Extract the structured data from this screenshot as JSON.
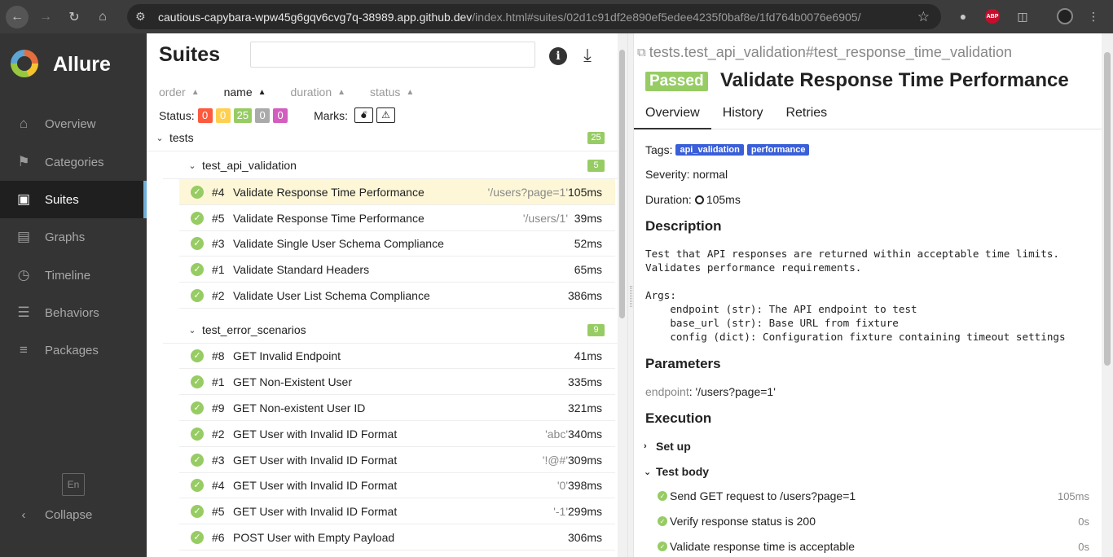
{
  "browser": {
    "url_host": "cautious-capybara-wpw45g6gqv6cvg7q-38989.app.github.dev",
    "url_path": "/index.html#suites/02d1c91df2e890ef5edee4235f0baf8e/1fd764b0076e6905/",
    "back_icon": "arrow-left",
    "forward_icon": "arrow-right",
    "reload_icon": "reload",
    "home_icon": "home",
    "abp_label": "ABP"
  },
  "sidebar": {
    "brand": "Allure",
    "items": [
      {
        "label": "Overview",
        "icon": "home"
      },
      {
        "label": "Categories",
        "icon": "flag"
      },
      {
        "label": "Suites",
        "icon": "briefcase"
      },
      {
        "label": "Graphs",
        "icon": "bar-chart"
      },
      {
        "label": "Timeline",
        "icon": "clock"
      },
      {
        "label": "Behaviors",
        "icon": "list"
      },
      {
        "label": "Packages",
        "icon": "align-left"
      }
    ],
    "active": "Suites",
    "lang": "En",
    "collapse": "Collapse"
  },
  "suites": {
    "title": "Suites",
    "search_placeholder": "",
    "sorters": [
      {
        "label": "order",
        "active": false
      },
      {
        "label": "name",
        "active": true
      },
      {
        "label": "duration",
        "active": false
      },
      {
        "label": "status",
        "active": false
      }
    ],
    "status_label": "Status:",
    "status_counts": [
      {
        "value": "0",
        "color": "#fd5a3e"
      },
      {
        "value": "0",
        "color": "#ffd050"
      },
      {
        "value": "25",
        "color": "#97cc64"
      },
      {
        "value": "0",
        "color": "#aaaaaa"
      },
      {
        "value": "0",
        "color": "#d35ebe"
      }
    ],
    "marks_label": "Marks:",
    "root": {
      "name": "tests",
      "count": "25"
    },
    "groups": [
      {
        "name": "test_api_validation",
        "count": "5",
        "rows": [
          {
            "num": "#4",
            "name": "Validate Response Time Performance",
            "param": "'/users?page=1'",
            "duration": "105ms",
            "selected": true
          },
          {
            "num": "#5",
            "name": "Validate Response Time Performance",
            "param": "'/users/1'",
            "duration": "39ms"
          },
          {
            "num": "#3",
            "name": "Validate Single User Schema Compliance",
            "param": "",
            "duration": "52ms"
          },
          {
            "num": "#1",
            "name": "Validate Standard Headers",
            "param": "",
            "duration": "65ms"
          },
          {
            "num": "#2",
            "name": "Validate User List Schema Compliance",
            "param": "",
            "duration": "386ms"
          }
        ]
      },
      {
        "name": "test_error_scenarios",
        "count": "9",
        "rows": [
          {
            "num": "#8",
            "name": "GET Invalid Endpoint",
            "param": "",
            "duration": "41ms"
          },
          {
            "num": "#1",
            "name": "GET Non-Existent User",
            "param": "",
            "duration": "335ms"
          },
          {
            "num": "#9",
            "name": "GET Non-existent User ID",
            "param": "",
            "duration": "321ms"
          },
          {
            "num": "#2",
            "name": "GET User with Invalid ID Format",
            "param": "'abc'",
            "duration": "340ms"
          },
          {
            "num": "#3",
            "name": "GET User with Invalid ID Format",
            "param": "'!@#'",
            "duration": "309ms"
          },
          {
            "num": "#4",
            "name": "GET User with Invalid ID Format",
            "param": "'0'",
            "duration": "398ms"
          },
          {
            "num": "#5",
            "name": "GET User with Invalid ID Format",
            "param": "'-1'",
            "duration": "299ms"
          },
          {
            "num": "#6",
            "name": "POST User with Empty Payload",
            "param": "",
            "duration": "306ms"
          }
        ]
      }
    ]
  },
  "detail": {
    "breadcrumb": "tests.test_api_validation#test_response_time_validation",
    "status": "Passed",
    "title": "Validate Response Time Performance",
    "tabs": [
      "Overview",
      "History",
      "Retries"
    ],
    "tags_label": "Tags:",
    "tags": [
      "api_validation",
      "performance"
    ],
    "severity": "Severity: normal",
    "duration_label": "Duration:",
    "duration": "105ms",
    "description_heading": "Description",
    "description": "Test that API responses are returned within acceptable time limits.\nValidates performance requirements.\n\nArgs:\n    endpoint (str): The API endpoint to test\n    base_url (str): Base URL from fixture\n    config (dict): Configuration fixture containing timeout settings",
    "parameters_heading": "Parameters",
    "param_key": "endpoint",
    "param_value": "'/users?page=1'",
    "execution_heading": "Execution",
    "setup_label": "Set up",
    "body_label": "Test body",
    "steps": [
      {
        "text": "Send GET request to /users?page=1",
        "duration": "105ms"
      },
      {
        "text": "Verify response status is 200",
        "duration": "0s"
      },
      {
        "text": "Validate response time is acceptable",
        "duration": "0s"
      }
    ]
  }
}
